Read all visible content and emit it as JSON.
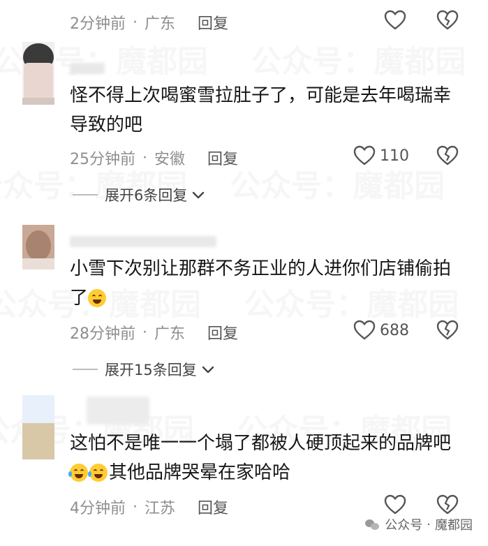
{
  "watermark": "公众号：魔都园",
  "comments": [
    {
      "text": "",
      "time": "2分钟前",
      "location": "广东",
      "reply_label": "回复",
      "likes": ""
    },
    {
      "text": "怪不得上次喝蜜雪拉肚子了，可能是去年喝瑞幸导致的吧",
      "time": "25分钟前",
      "location": "安徽",
      "reply_label": "回复",
      "likes": "110",
      "expand_label": "展开6条回复"
    },
    {
      "text": "小雪下次别让那群不务正业的人进你们店铺偷拍了",
      "time": "28分钟前",
      "location": "广东",
      "reply_label": "回复",
      "likes": "688",
      "expand_label": "展开15条回复"
    },
    {
      "text_part1": "这怕不是唯一一个塌了都被人硬顶起来的品牌吧",
      "text_part2": "其他品牌哭晕在家哈哈",
      "time": "4分钟前",
      "location": "江苏",
      "reply_label": "回复",
      "likes": ""
    }
  ],
  "footer": {
    "account_prefix": "公众号",
    "separator": "·",
    "account_name": "魔都园"
  },
  "icons": {
    "like": "heart-outline-icon",
    "dislike": "broken-heart-icon",
    "expand": "chevron-down-icon",
    "emoji_hug": "hugging-face-emoji",
    "emoji_laugh": "laughing-tears-emoji"
  }
}
